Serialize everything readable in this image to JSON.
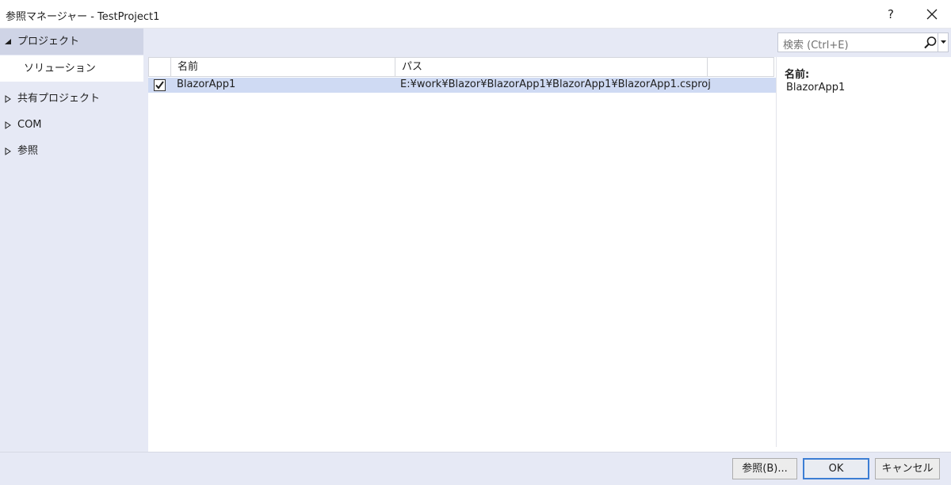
{
  "window": {
    "title": "参照マネージャー - TestProject1",
    "help_label": "?",
    "close_icon": "close-icon"
  },
  "sidebar": {
    "items": [
      {
        "label": "プロジェクト",
        "expanded": true,
        "icon": "triangle-expanded-icon"
      },
      {
        "label": "ソリューション",
        "selected": true
      },
      {
        "label": "共有プロジェクト",
        "expanded": false,
        "icon": "triangle-collapsed-icon"
      },
      {
        "label": "COM",
        "expanded": false,
        "icon": "triangle-collapsed-icon"
      },
      {
        "label": "参照",
        "expanded": false,
        "icon": "triangle-collapsed-icon"
      }
    ]
  },
  "search": {
    "placeholder": "検索 (Ctrl+E)",
    "icon": "search-icon",
    "dropdown_icon": "dropdown-arrow-icon"
  },
  "table": {
    "columns": [
      "名前",
      "パス"
    ],
    "rows": [
      {
        "checked": true,
        "name": "BlazorApp1",
        "path": "E:¥work¥Blazor¥BlazorApp1¥BlazorApp1¥BlazorApp1.csproj"
      }
    ]
  },
  "details": {
    "name_label": "名前:",
    "name_value": "BlazorApp1"
  },
  "footer": {
    "browse_label": "参照(B)...",
    "ok_label": "OK",
    "cancel_label": "キャンセル"
  },
  "colors": {
    "panel_bg": "#e6e9f5",
    "selected_row": "#cfdaf3",
    "default_button_border": "#3d7ed4"
  }
}
